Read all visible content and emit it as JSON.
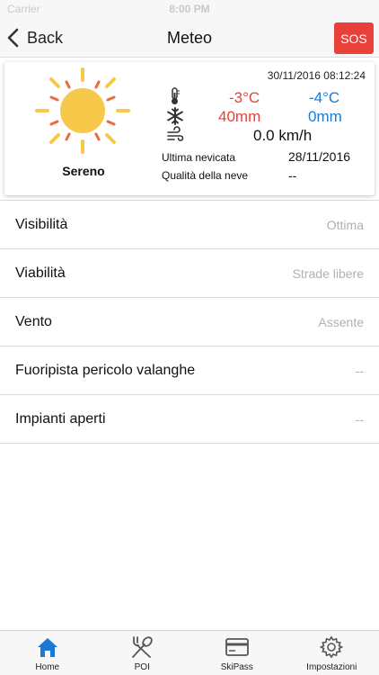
{
  "status_bar": {
    "carrier": "Carrier",
    "time": "8:00 PM"
  },
  "nav": {
    "back_label": "Back",
    "title": "Meteo",
    "sos_label": "SOS"
  },
  "weather": {
    "datetime": "30/11/2016 08:12:24",
    "condition": "Sereno",
    "temperature": {
      "max": "-3°C",
      "min": "-4°C"
    },
    "snow": {
      "max": "40mm",
      "min": "0mm"
    },
    "wind": "0.0 km/h",
    "last_snowfall_label": "Ultima nevicata",
    "last_snowfall_value": "28/11/2016",
    "snow_quality_label": "Qualità della neve",
    "snow_quality_value": "--",
    "icons": {
      "condition": "sun-icon",
      "temperature": "thermometer-icon",
      "snow": "snowflake-icon",
      "wind": "wind-icon"
    }
  },
  "info_rows": [
    {
      "label": "Visibilità",
      "value": "Ottima"
    },
    {
      "label": "Viabilità",
      "value": "Strade libere"
    },
    {
      "label": "Vento",
      "value": "Assente"
    },
    {
      "label": "Fuoripista pericolo valanghe",
      "value": "--"
    },
    {
      "label": "Impianti aperti",
      "value": "--"
    }
  ],
  "tabs": [
    {
      "label": "Home",
      "icon": "home-icon"
    },
    {
      "label": "POI",
      "icon": "fork-spoon-icon"
    },
    {
      "label": "SkiPass",
      "icon": "card-icon"
    },
    {
      "label": "Impostazioni",
      "icon": "gear-icon"
    }
  ],
  "colors": {
    "accent": "#1a79d6",
    "sos": "#e8403a",
    "hot": "#e8403a",
    "cold": "#1a79d6",
    "sun": "#f6c94a"
  }
}
